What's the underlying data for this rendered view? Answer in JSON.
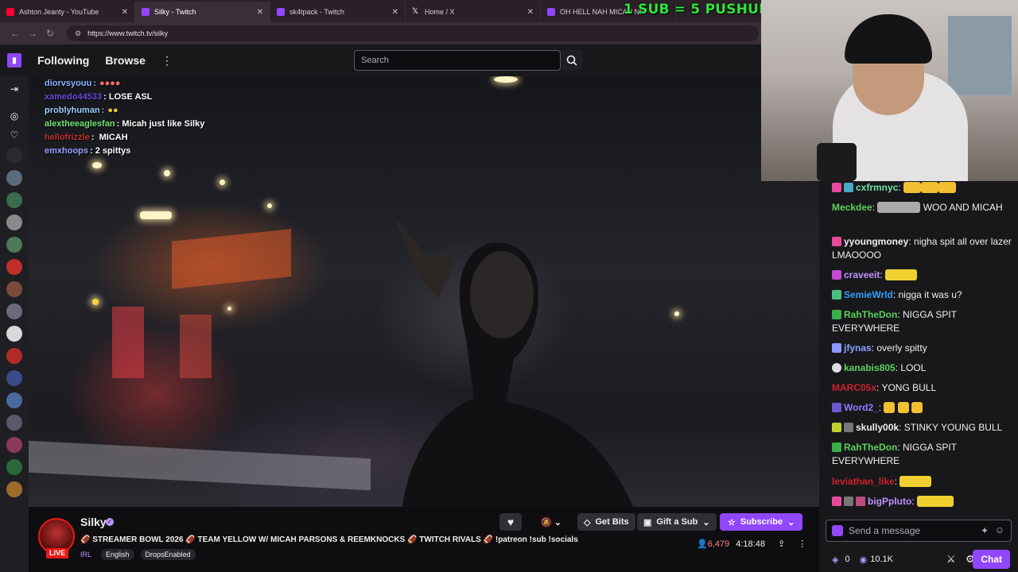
{
  "browser": {
    "tabs": [
      {
        "title": "Ashton Jeanty - YouTube",
        "color": "#ff0033"
      },
      {
        "title": "Silky - Twitch",
        "color": "#9146ff"
      },
      {
        "title": "sk4tpack - Twitch",
        "color": "#9146ff"
      },
      {
        "title": "Home / X",
        "color": "#ffffff"
      },
      {
        "title": "OH HELL NAH MICAH NIC",
        "color": "#9146ff"
      }
    ],
    "url": "https://www.twitch.tv/silky"
  },
  "overlay_banner": "1 SUB = 5 PUSHUPS",
  "nav": {
    "following": "Following",
    "browse": "Browse",
    "more": "⋮",
    "search_placeholder": "Search"
  },
  "video_chat_overlay": [
    {
      "user": "diorvsyouu",
      "text": "",
      "color": "#8ab4ff"
    },
    {
      "user": "xamedo44533",
      "text": "LOSE ASL",
      "color": "#6a4bd8"
    },
    {
      "user": "problyhuman",
      "text": "",
      "color": "#9ad0ff"
    },
    {
      "user": "alextheeaglesfan",
      "text": "Micah  just like Silky",
      "color": "#6ee66e"
    },
    {
      "user": "hellofrizzle",
      "text": "MICAH",
      "color": "#c03030"
    },
    {
      "user": "emxhoops",
      "text": "2 spittys",
      "color": "#9aa4ff"
    }
  ],
  "chat": {
    "messages": [
      {
        "user": "cxfrmnyc",
        "text": "",
        "color": "#6ee6a0"
      },
      {
        "user": "Meckdee",
        "text": "WOO AND MICAH",
        "color": "#5ad25a"
      },
      {
        "user": "yyoungmoney",
        "text": "nigha spit all over lazer LMAOOOO",
        "color": "#efeff1"
      },
      {
        "user": "craveeit",
        "text": "",
        "color": "#bf94ff"
      },
      {
        "user": "SemieWrld",
        "text": "nigga it was u?",
        "color": "#2fa0ff"
      },
      {
        "user": "RahTheDon",
        "text": "NIGGA SPIT EVERYWHERE",
        "color": "#5ad25a"
      },
      {
        "user": "jfynas",
        "text": "overly spitty",
        "color": "#8aa0ff"
      },
      {
        "user": "kanabis805",
        "text": "LOOL",
        "color": "#5ad25a"
      },
      {
        "user": "MARC05x",
        "text": "YONG BULL",
        "color": "#d0202a"
      },
      {
        "user": "Word2_",
        "text": "",
        "color": "#8a7cff"
      },
      {
        "user": "skully00k",
        "text": "STINKY YOUNG BULL",
        "color": "#efeff1"
      },
      {
        "user": "RahTheDon",
        "text": "NIGGA SPIT EVERYWHERE",
        "color": "#5ad25a"
      },
      {
        "user": "leviathan_like",
        "text": "",
        "color": "#d0202a"
      },
      {
        "user": "bigPpluto",
        "text": "",
        "color": "#bf94ff"
      }
    ],
    "input_placeholder": "Send a message",
    "points": "0",
    "bits": "10.1K",
    "chat_button": "Chat"
  },
  "stream": {
    "streamer": "Silky",
    "live_label": "LIVE",
    "title": "🏈 STREAMER BOWL 2026 🏈 TEAM YELLOW W/ MICAH PARSONS & REEMKNOCKS 🏈 TWITCH RIVALS 🏈 !patreon !sub !socials",
    "category": "IRL",
    "tags": [
      "English",
      "DropsEnabled"
    ],
    "get_bits": "Get Bits",
    "gift_sub": "Gift a Sub",
    "subscribe": "Subscribe",
    "viewers": "6,479",
    "uptime": "4:18:48"
  },
  "colors": {
    "accent": "#9146ff",
    "live": "#e91916",
    "banner": "#2ee63a"
  }
}
